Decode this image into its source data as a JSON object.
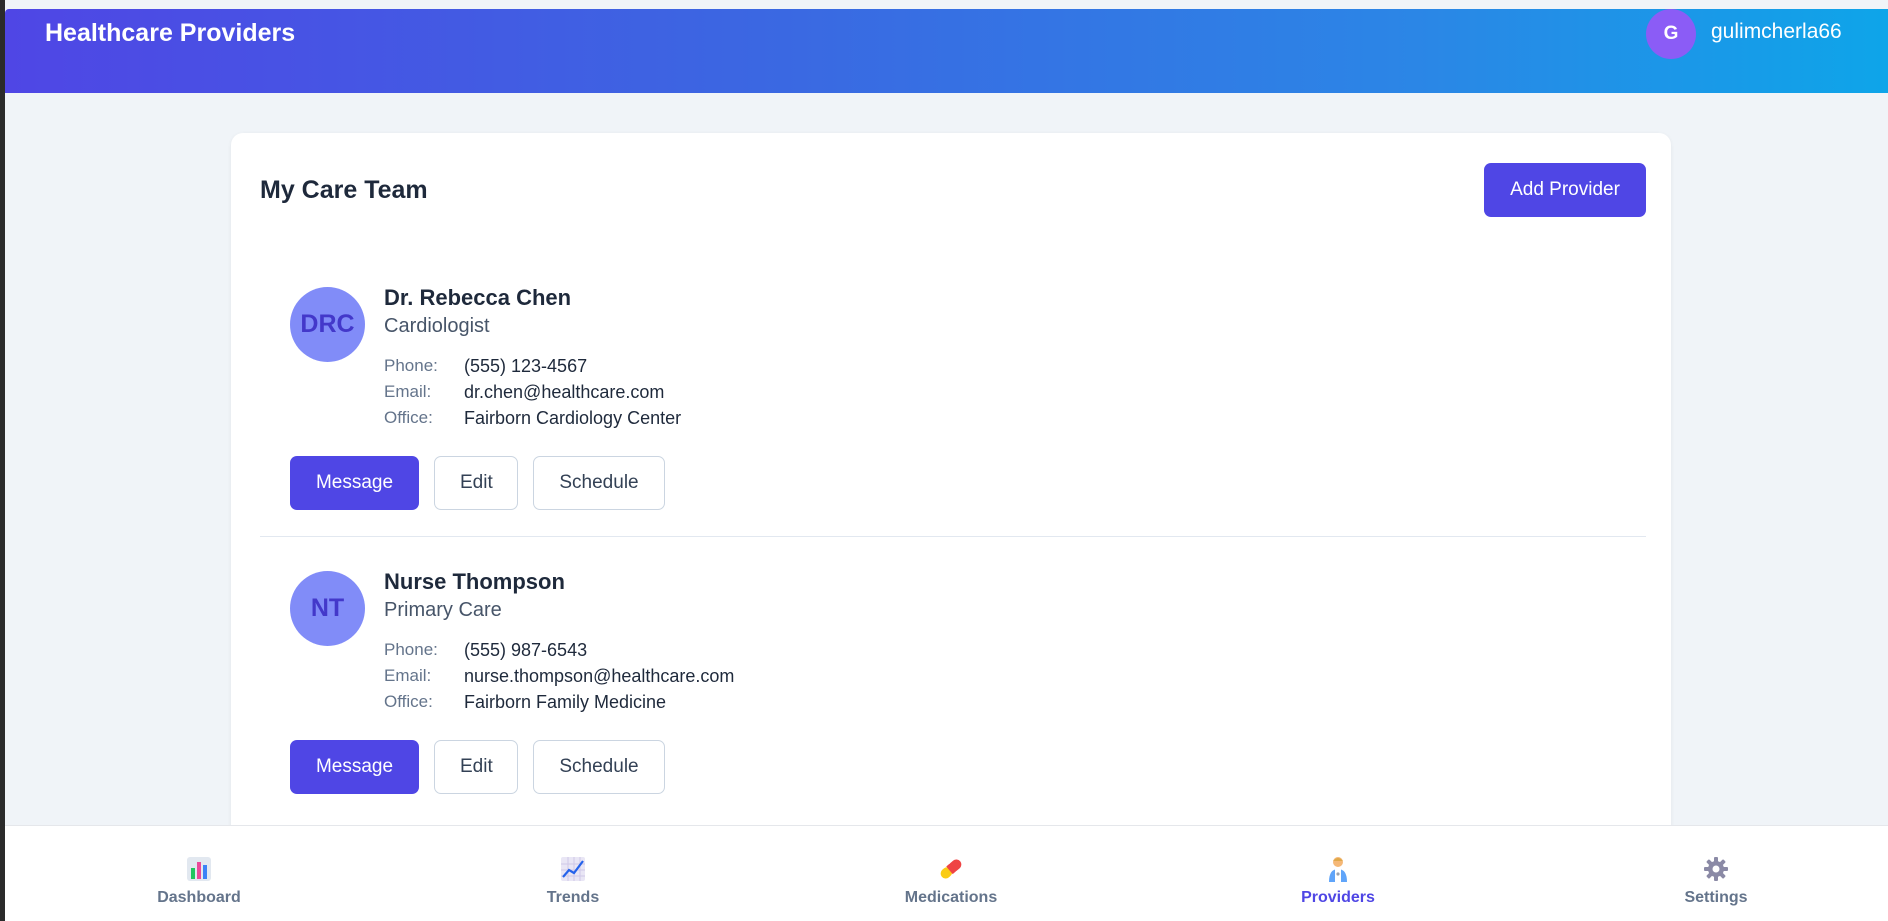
{
  "header": {
    "title": "Healthcare Providers",
    "user_initial": "G",
    "username": "gulimcherla66"
  },
  "care_team": {
    "title": "My Care Team",
    "add_button_label": "Add Provider",
    "field_labels": {
      "phone": "Phone:",
      "email": "Email:",
      "office": "Office:"
    },
    "providers": [
      {
        "initials": "DRC",
        "name": "Dr. Rebecca Chen",
        "role": "Cardiologist",
        "phone": "(555) 123-4567",
        "email": "dr.chen@healthcare.com",
        "office": "Fairborn Cardiology Center"
      },
      {
        "initials": "NT",
        "name": "Nurse Thompson",
        "role": "Primary Care",
        "phone": "(555) 987-6543",
        "email": "nurse.thompson@healthcare.com",
        "office": "Fairborn Family Medicine"
      }
    ],
    "actions": {
      "message": "Message",
      "edit": "Edit",
      "schedule": "Schedule"
    }
  },
  "bottom_nav": {
    "active": "Providers",
    "items": [
      {
        "label": "Dashboard",
        "icon": "bar-chart-icon"
      },
      {
        "label": "Trends",
        "icon": "trend-chart-icon"
      },
      {
        "label": "Medications",
        "icon": "pill-icon"
      },
      {
        "label": "Providers",
        "icon": "health-worker-icon"
      },
      {
        "label": "Settings",
        "icon": "gear-icon"
      }
    ]
  },
  "colors": {
    "primary": "#4f46e5",
    "header_gradient_start": "#4f46e5",
    "header_gradient_end": "#0ea5e9",
    "avatar_bg": "#818cf8",
    "page_bg": "#f0f4f8"
  }
}
